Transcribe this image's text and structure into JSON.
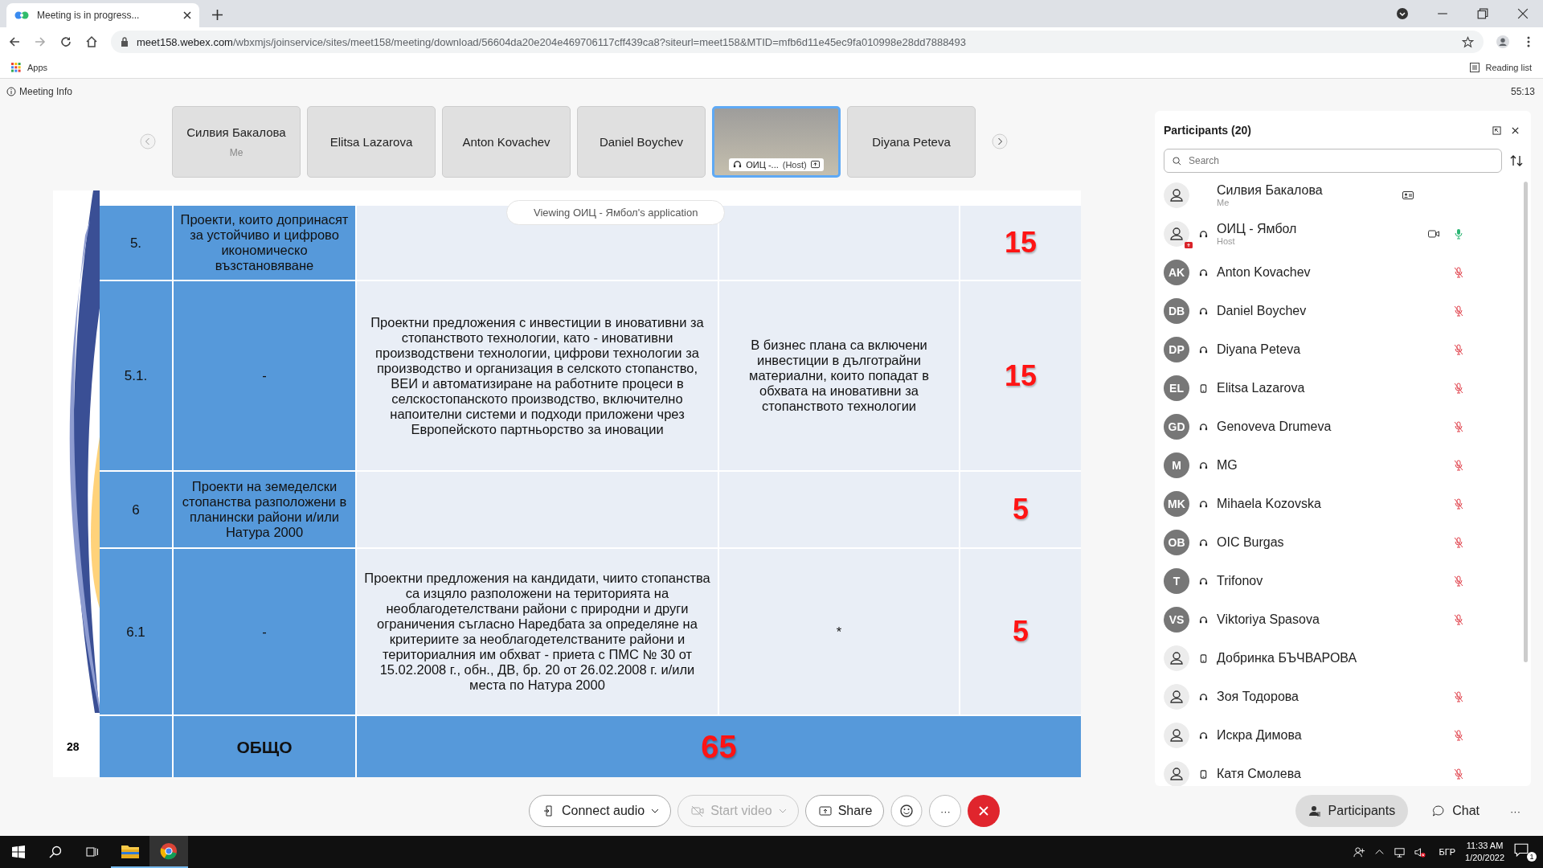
{
  "browser": {
    "tab_title": "Meeting is in progress...",
    "url_host": "meet158.webex.com",
    "url_path": "/wbxmjs/joinservice/sites/meet158/meeting/download/56604da20e204e469706117cff439ca8?siteurl=meet158&MTID=mfb6d11e45ec9fa010998e28dd7888493",
    "bookmark": "Apps",
    "reading_list": "Reading list"
  },
  "meeting": {
    "info_label": "Meeting Info",
    "timer": "55:13"
  },
  "thumbnails": [
    {
      "kind": "name",
      "name": "Силвия Бакалова",
      "subtitle": "Me",
      "selected": false
    },
    {
      "kind": "name",
      "name": "Elitsa Lazarova",
      "selected": false
    },
    {
      "kind": "name",
      "name": "Anton Kovachev",
      "selected": false
    },
    {
      "kind": "name",
      "name": "Daniel Boychev",
      "selected": false
    },
    {
      "kind": "video",
      "name": "ОИЦ -...",
      "subtitle": "(Host)",
      "selected": true
    },
    {
      "kind": "name",
      "name": "Diyana Peteva",
      "selected": false
    }
  ],
  "slide": {
    "viewing_banner": "Viewing ОИЦ - Ямбол's application",
    "page_number": "28",
    "rows": [
      {
        "number": "5.",
        "criterion": "Проекти, които допринасят за устойчиво и цифрово икономическо възстановяване",
        "description": "",
        "evidence": "",
        "points": "15"
      },
      {
        "number": "5.1.",
        "criterion": "-",
        "description": "Проектни предложения с инвестиции в иновативни за стопанството технологии, като - иновативни производствени технологии, цифрови технологии за производство и организация в селското стопанство, ВЕИ и автоматизиране на работните процеси в селскостопанското производство, включително напоителни системи и подходи приложени чрез Европейското партньорство за иновации",
        "evidence": "В бизнес плана са включени инвестиции в дълготрайни материални, които попадат в обхвата на иновативни за стопанството технологии",
        "points": "15"
      },
      {
        "number": "6",
        "criterion": "Проекти на земеделски стопанства разположени в планински райони и/или Натура 2000",
        "description": "",
        "evidence": "",
        "points": "5"
      },
      {
        "number": "6.1",
        "criterion": "-",
        "description": "Проектни предложения на кандидати, чиито стопанства са изцяло разположени на територията на необлагодетелствани райони с природни и други ограничения съгласно Наредбата за определяне на критериите за необлагодетелстваните райони и териториалния им обхват - приета с ПМС № 30 от 15.02.2008 г., обн., ДВ, бр. 20 от 26.02.2008 г. и/или места по Натура 2000",
        "evidence": "*",
        "points": "5"
      }
    ],
    "total": {
      "label": "ОБЩО",
      "points": "65"
    }
  },
  "participants": {
    "title": "Participants (20)",
    "search_placeholder": "Search",
    "items": [
      {
        "kind": "self",
        "name": "Силвия Бакалова",
        "subtitle": "Me"
      },
      {
        "kind": "host",
        "name": "ОИЦ - Ямбол",
        "subtitle": "Host",
        "phone": false,
        "muted": false
      },
      {
        "kind": "attendee",
        "initials": "AK",
        "name": "Anton Kovachev",
        "phone": false,
        "muted": true
      },
      {
        "kind": "attendee",
        "initials": "DB",
        "name": "Daniel Boychev",
        "phone": false,
        "muted": true
      },
      {
        "kind": "attendee",
        "initials": "DP",
        "name": "Diyana Peteva",
        "phone": false,
        "muted": true
      },
      {
        "kind": "attendee",
        "initials": "EL",
        "name": "Elitsa Lazarova",
        "phone": true,
        "muted": true
      },
      {
        "kind": "attendee",
        "initials": "GD",
        "name": "Genoveva Drumeva",
        "phone": false,
        "muted": true
      },
      {
        "kind": "attendee",
        "initials": "M",
        "name": "MG",
        "phone": false,
        "muted": true
      },
      {
        "kind": "attendee",
        "initials": "MK",
        "name": "Mihaela Kozovska",
        "phone": false,
        "muted": true
      },
      {
        "kind": "attendee",
        "initials": "OB",
        "name": "OIC Burgas",
        "phone": false,
        "muted": true
      },
      {
        "kind": "attendee",
        "initials": "T",
        "name": "Trifonov",
        "phone": false,
        "muted": true
      },
      {
        "kind": "attendee",
        "initials": "VS",
        "name": "Viktoriya Spasova",
        "phone": false,
        "muted": true
      },
      {
        "kind": "attendee",
        "name": "Добринка БЪЧВАРОВА",
        "phone": true
      },
      {
        "kind": "attendee",
        "name": "Зоя Тодорова",
        "phone": false,
        "muted": true
      },
      {
        "kind": "attendee",
        "name": "Искра Димова",
        "phone": false,
        "muted": true
      },
      {
        "kind": "attendee",
        "name": "Катя Смолева",
        "phone": true,
        "muted": true
      }
    ]
  },
  "toolbar": {
    "buttons": [
      {
        "kind": "audio",
        "label": "Connect audio",
        "disabled": false
      },
      {
        "kind": "video",
        "label": "Start video",
        "disabled": true
      },
      {
        "kind": "share",
        "label": "Share",
        "disabled": false
      }
    ],
    "more": "···",
    "side_buttons": [
      {
        "kind": "participants",
        "label": "Participants",
        "selected": true
      },
      {
        "kind": "chat",
        "label": "Chat",
        "selected": false
      }
    ],
    "side_more": "···"
  },
  "taskbar": {
    "language": "БГР",
    "time": "11:33 AM",
    "date": "1/20/2022",
    "notifications": "1"
  }
}
